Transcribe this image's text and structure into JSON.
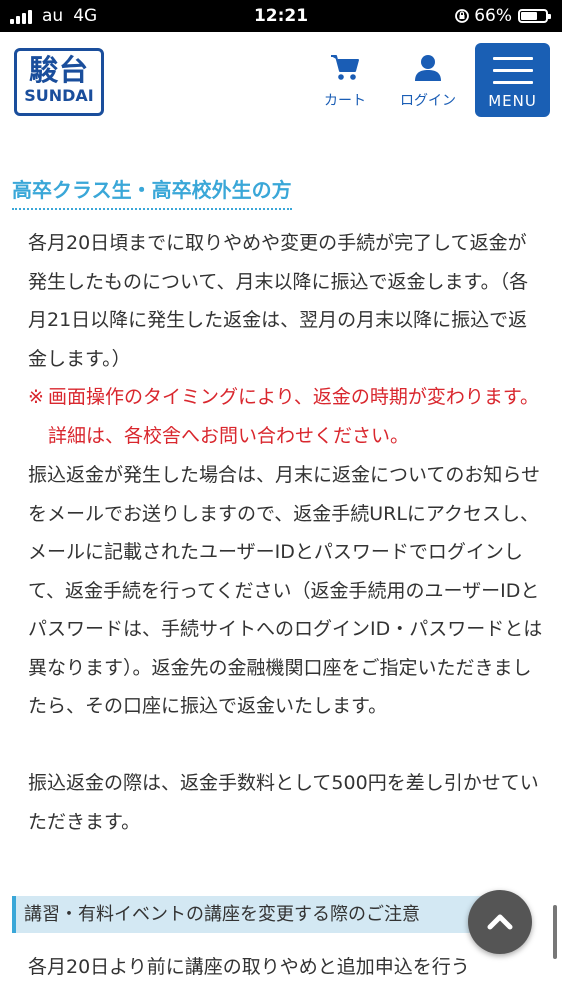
{
  "status_bar": {
    "carrier": "au",
    "network": "4G",
    "time": "12:21",
    "battery": "66%",
    "battery_level": 0.66
  },
  "header": {
    "logo_kanji": "駿台",
    "logo_roman": "SUNDAI",
    "cart_label": "カート",
    "login_label": "ログイン",
    "menu_label": "MENU"
  },
  "section": {
    "title": "高卒クラス生・高卒校外生の方",
    "para1": "各月20日頃までに取りやめや変更の手続が完了して返金が発生したものについて、月末以降に振込で返金します。（各月21日以降に発生した返金は、翌月の月末以降に振込で返金します。）",
    "warning_mark": "※",
    "warning": "画面操作のタイミングにより、返金の時期が変わります。詳細は、各校舎へお問い合わせください。",
    "para2": "振込返金が発生した場合は、月末に返金についてのお知らせをメールでお送りしますので、返金手続URLにアクセスし、メールに記載されたユーザーIDとパスワードでログインして、返金手続を行ってください（返金手続用のユーザーIDとパスワードは、手続サイトへのログインID・パスワードとは異なります）。返金先の金融機関口座をご指定いただきましたら、その口座に振込で返金いたします。",
    "para3": "振込返金の際は、返金手数料として500円を差し引かせていただきます。"
  },
  "notice": {
    "title": "講習・有料イベントの講座を変更する際のご注意",
    "text": "各月20日より前に講座の取りやめと追加申込を行う"
  },
  "colors": {
    "brand": "#1a4e9c",
    "menu_bg": "#1a5fb4",
    "section_title": "#3aa7d8",
    "warning": "#d9272e",
    "notice_bg": "#d3e8f3"
  },
  "icons": {
    "cart": "cart-icon",
    "login": "user-icon",
    "menu": "hamburger-icon",
    "scroll_top": "chevron-up-icon"
  }
}
